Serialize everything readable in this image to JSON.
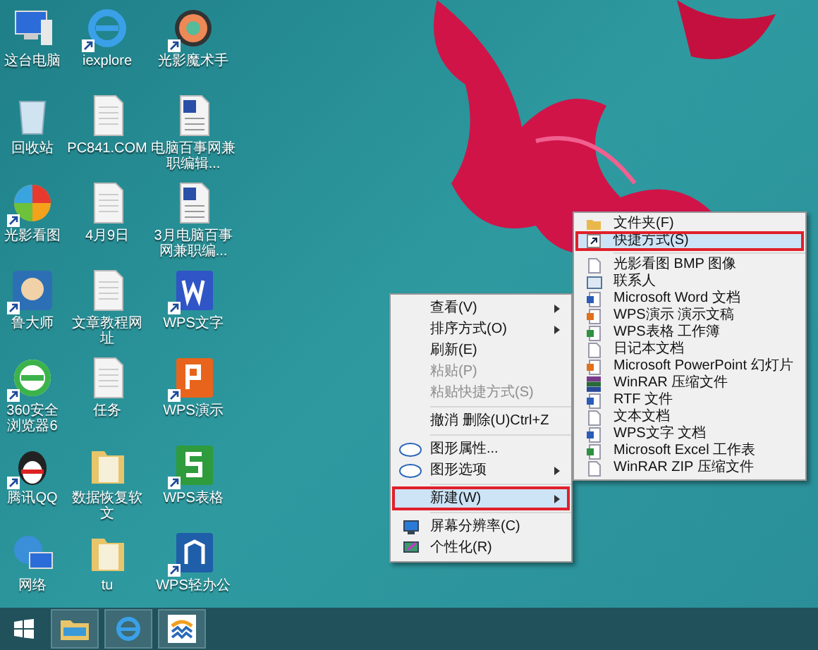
{
  "desktop_icons": [
    {
      "label": "这台电脑",
      "kind": "computer",
      "shortcut": false
    },
    {
      "label": "iexplore",
      "kind": "ie",
      "shortcut": true
    },
    {
      "label": "光影魔术手",
      "kind": "aperture",
      "shortcut": true
    },
    {
      "label": "回收站",
      "kind": "recycle",
      "shortcut": false
    },
    {
      "label": "PC841.COM",
      "kind": "text",
      "shortcut": false
    },
    {
      "label": "电脑百事网兼职编辑...",
      "kind": "word",
      "shortcut": false
    },
    {
      "label": "光影看图",
      "kind": "color-wheel",
      "shortcut": true
    },
    {
      "label": "4月9日",
      "kind": "text",
      "shortcut": false
    },
    {
      "label": "3月电脑百事网兼职编...",
      "kind": "word",
      "shortcut": false
    },
    {
      "label": "鲁大师",
      "kind": "mascot",
      "shortcut": true
    },
    {
      "label": "文章教程网址",
      "kind": "text",
      "shortcut": false
    },
    {
      "label": "WPS文字",
      "kind": "wps-w",
      "shortcut": true
    },
    {
      "label": "360安全浏览器6",
      "kind": "browser-360",
      "shortcut": true
    },
    {
      "label": "任务",
      "kind": "text",
      "shortcut": false
    },
    {
      "label": "WPS演示",
      "kind": "wps-p",
      "shortcut": true
    },
    {
      "label": "腾讯QQ",
      "kind": "penguin",
      "shortcut": true
    },
    {
      "label": "数据恢复软文",
      "kind": "folder",
      "shortcut": false
    },
    {
      "label": "WPS表格",
      "kind": "wps-s",
      "shortcut": true
    },
    {
      "label": "网络",
      "kind": "network",
      "shortcut": false
    },
    {
      "label": "tu",
      "kind": "folder",
      "shortcut": false
    },
    {
      "label": "WPS轻办公",
      "kind": "wps-cloud",
      "shortcut": true
    }
  ],
  "context_menu": {
    "items": [
      {
        "kind": "item",
        "label": "查看(V)",
        "disabled": false,
        "submenu": true,
        "selected": false
      },
      {
        "kind": "item",
        "label": "排序方式(O)",
        "disabled": false,
        "submenu": true,
        "selected": false
      },
      {
        "kind": "item",
        "label": "刷新(E)",
        "disabled": false,
        "submenu": false,
        "selected": false
      },
      {
        "kind": "item",
        "label": "粘贴(P)",
        "disabled": true,
        "submenu": false,
        "selected": false
      },
      {
        "kind": "item",
        "label": "粘贴快捷方式(S)",
        "disabled": true,
        "submenu": false,
        "selected": false
      },
      {
        "kind": "separator"
      },
      {
        "kind": "item",
        "label": "撤消 删除(U)",
        "shortcut": "Ctrl+Z",
        "disabled": false,
        "submenu": false,
        "selected": false
      },
      {
        "kind": "separator"
      },
      {
        "kind": "item",
        "label": "图形属性...",
        "disabled": false,
        "submenu": false,
        "selected": false
      },
      {
        "kind": "item",
        "label": "图形选项",
        "disabled": false,
        "submenu": true,
        "selected": false
      },
      {
        "kind": "separator"
      },
      {
        "kind": "item",
        "label": "新建(W)",
        "disabled": false,
        "submenu": true,
        "selected": true
      },
      {
        "kind": "separator"
      },
      {
        "kind": "item",
        "label": "屏幕分辨率(C)",
        "disabled": false,
        "submenu": false,
        "selected": false
      },
      {
        "kind": "item",
        "label": "个性化(R)",
        "disabled": false,
        "submenu": false,
        "selected": false
      }
    ]
  },
  "new_submenu": {
    "items": [
      {
        "kind": "item",
        "label": "文件夹(F)",
        "selected": false
      },
      {
        "kind": "item",
        "label": "快捷方式(S)",
        "selected": true
      },
      {
        "kind": "separator"
      },
      {
        "kind": "item",
        "label": "光影看图 BMP 图像",
        "selected": false
      },
      {
        "kind": "item",
        "label": "联系人",
        "selected": false
      },
      {
        "kind": "item",
        "label": "Microsoft Word 文档",
        "selected": false
      },
      {
        "kind": "item",
        "label": "WPS演示 演示文稿",
        "selected": false
      },
      {
        "kind": "item",
        "label": "WPS表格 工作簿",
        "selected": false
      },
      {
        "kind": "item",
        "label": "日记本文档",
        "selected": false
      },
      {
        "kind": "item",
        "label": "Microsoft PowerPoint 幻灯片",
        "selected": false
      },
      {
        "kind": "item",
        "label": "WinRAR 压缩文件",
        "selected": false
      },
      {
        "kind": "item",
        "label": "RTF 文件",
        "selected": false
      },
      {
        "kind": "item",
        "label": "文本文档",
        "selected": false
      },
      {
        "kind": "item",
        "label": "WPS文字 文档",
        "selected": false
      },
      {
        "kind": "item",
        "label": "Microsoft Excel 工作表",
        "selected": false
      },
      {
        "kind": "item",
        "label": "WinRAR ZIP 压缩文件",
        "selected": false
      }
    ]
  },
  "taskbar": {
    "items": [
      {
        "kind": "explorer"
      },
      {
        "kind": "ie"
      },
      {
        "kind": "app"
      }
    ]
  }
}
